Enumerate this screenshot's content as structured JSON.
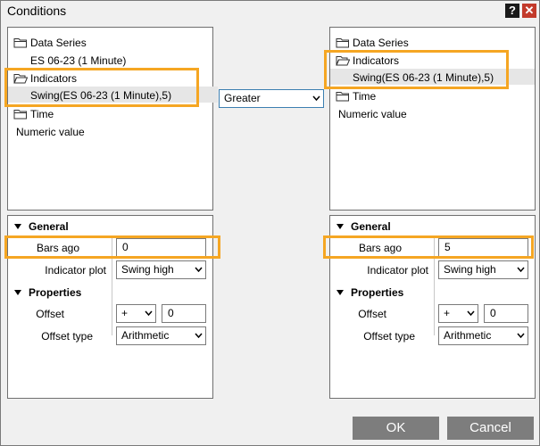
{
  "window": {
    "title": "Conditions",
    "help_label": "?",
    "close_label": "✕"
  },
  "left": {
    "tree": {
      "data_series": "Data Series",
      "data_series_value": "ES 06-23 (1 Minute)",
      "indicators": "Indicators",
      "indicator_value": "Swing(ES 06-23 (1 Minute),5)",
      "time": "Time",
      "numeric": "Numeric value"
    },
    "props": {
      "general": "General",
      "bars_ago_label": "Bars ago",
      "bars_ago_value": "0",
      "indicator_plot_label": "Indicator plot",
      "indicator_plot_value": "Swing high",
      "properties": "Properties",
      "offset_label": "Offset",
      "offset_op": "+",
      "offset_value": "0",
      "offset_type_label": "Offset type",
      "offset_type_value": "Arithmetic"
    }
  },
  "operator": {
    "value": "Greater"
  },
  "right": {
    "tree": {
      "data_series": "Data Series",
      "indicators": "Indicators",
      "indicator_value": "Swing(ES 06-23 (1 Minute),5)",
      "time": "Time",
      "numeric": "Numeric value"
    },
    "props": {
      "general": "General",
      "bars_ago_label": "Bars ago",
      "bars_ago_value": "5",
      "indicator_plot_label": "Indicator plot",
      "indicator_plot_value": "Swing high",
      "properties": "Properties",
      "offset_label": "Offset",
      "offset_op": "+",
      "offset_value": "0",
      "offset_type_label": "Offset type",
      "offset_type_value": "Arithmetic"
    }
  },
  "buttons": {
    "ok": "OK",
    "cancel": "Cancel"
  },
  "colors": {
    "highlight": "#f5a623",
    "button": "#7d7d7d",
    "close": "#c23a2b"
  }
}
